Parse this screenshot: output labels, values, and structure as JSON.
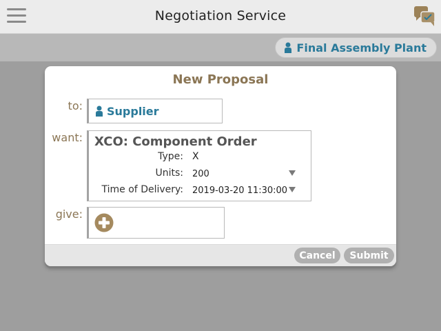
{
  "header": {
    "title": "Negotiation Service",
    "menu_icon": "hamburger-menu-icon",
    "chat_icon": "chat-bubbles-icon"
  },
  "subheader": {
    "user": "Final Assembly Plant",
    "user_icon": "person-icon"
  },
  "dialog": {
    "title": "New Proposal",
    "to_label": "to:",
    "to_value": "Supplier",
    "want_label": "want:",
    "want": {
      "title": "XCO: Component Order",
      "type_label": "Type:",
      "type_value": "X",
      "units_label": "Units:",
      "units_value": "200",
      "delivery_label": "Time of Delivery:",
      "delivery_value": "2019-03-20 11:30:00"
    },
    "give_label": "give:",
    "add_icon": "plus-circle-icon",
    "cancel_label": "Cancel",
    "submit_label": "Submit"
  },
  "colors": {
    "accent_brown": "#8b7655",
    "link_blue": "#2a7a9a",
    "overlay_gray": "#9e9e9e",
    "button_gray": "#b0b0b0"
  }
}
